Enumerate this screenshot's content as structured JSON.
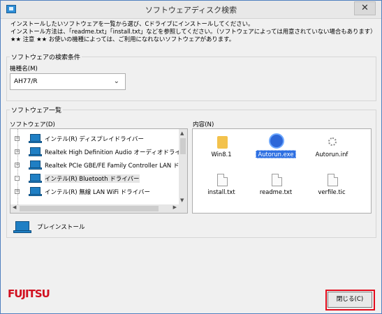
{
  "window": {
    "title": "ソフトウェアディスク検索",
    "close_glyph": "✕"
  },
  "instructions": [
    "インストールしたいソフトウェアを一覧から選び、Cドライブにインストールしてください。",
    "インストール方法は、「readme.txt」「install.txt」などを参照してください。（ソフトウェアによっては用意されていない場合もあります）",
    "★★ 注意 ★★ お使いの機種によっては、ご利用になれないソフトウェアがあります。"
  ],
  "search_conditions": {
    "group_label": "ソフトウェアの検索条件",
    "model_label": "機種名(M)",
    "model_value": "AH77/R",
    "dropdown_icon": "chevron-down-icon"
  },
  "software_list": {
    "group_label": "ソフトウェア一覧",
    "software_label": "ソフトウェア(D)",
    "contents_label": "内容(N)",
    "items": [
      {
        "label": "インテル(R) ディスプレイドライバー",
        "icon": "monitor-device-icon"
      },
      {
        "label": "Realtek High Definition Audio オーディオドライ",
        "icon": "monitor-device-icon"
      },
      {
        "label": "Realtek PCIe GBE/FE Family Controller LAN ド",
        "icon": "monitor-device-icon"
      },
      {
        "label": "インテル(R) Bluetooth ドライバー",
        "icon": "monitor-device-icon",
        "selected": true
      },
      {
        "label": "インテル(R) 無線 LAN WiFi ドライバー",
        "icon": "monitor-device-icon"
      }
    ],
    "files": [
      {
        "name": "Win8.1",
        "icon": "folder-icon"
      },
      {
        "name": "Autorun.exe",
        "icon": "wireless-icon",
        "selected": true
      },
      {
        "name": "Autorun.inf",
        "icon": "settings-file-icon"
      },
      {
        "name": "install.txt",
        "icon": "text-file-icon"
      },
      {
        "name": "readme.txt",
        "icon": "text-file-icon"
      },
      {
        "name": "verfile.tic",
        "icon": "text-file-icon"
      }
    ]
  },
  "preinstall": {
    "label": "プレインストール",
    "icon": "monitor-device-icon"
  },
  "footer": {
    "logo": "FUJITSU",
    "close_button": "閉じる(C)"
  },
  "colors": {
    "selection_blue": "#2d6fe2",
    "highlight_red": "#e30b1c",
    "logo_red": "#d10f1f"
  }
}
